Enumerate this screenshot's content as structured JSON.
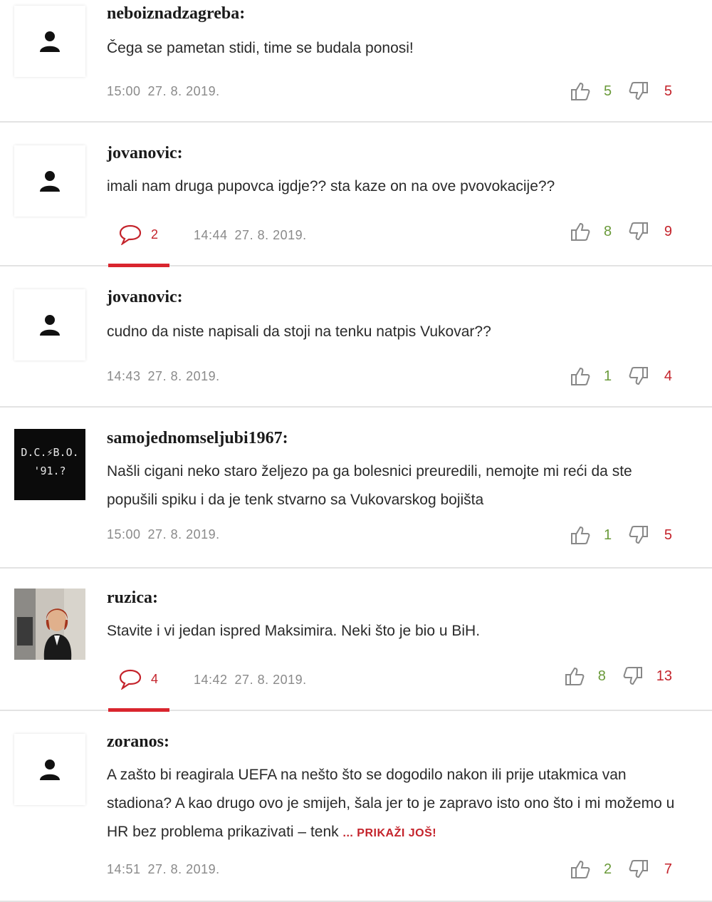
{
  "comments": [
    {
      "user": "neboiznadzagreba:",
      "text": "Čega se pametan stidi, time se budala ponosi!",
      "time": "15:00",
      "date": "27. 8. 2019.",
      "likes": "5",
      "dislikes": "5",
      "avatar": "default-user-icon"
    },
    {
      "user": "jovanovic:",
      "text": "imali nam druga pupovca igdje?? sta kaze on na ove pvovokacije??",
      "replies": "2",
      "time": "14:44",
      "date": "27. 8. 2019.",
      "likes": "8",
      "dislikes": "9",
      "avatar": "default-user-icon"
    },
    {
      "user": "jovanovic:",
      "text": "cudno da niste napisali da stoji na tenku natpis Vukovar??",
      "time": "14:43",
      "date": "27. 8. 2019.",
      "likes": "1",
      "dislikes": "4",
      "avatar": "default-user-icon"
    },
    {
      "user": "samojednomseljubi1967:",
      "text": "Našli cigani neko staro željezo pa ga bolesnici preuredili, nemojte mi reći da ste popušili spiku i da je tenk stvarno sa Vukovarskog bojišta",
      "time": "15:00",
      "date": "27. 8. 2019.",
      "likes": "1",
      "dislikes": "5",
      "avatar": "black-patch-image",
      "avatar_text_1": "D.C.⚡B.O.",
      "avatar_text_2": "'91.?"
    },
    {
      "user": "ruzica:",
      "text": "Stavite i vi jedan ispred Maksimira. Neki što je bio u BiH.",
      "replies": "4",
      "time": "14:42",
      "date": "27. 8. 2019.",
      "likes": "8",
      "dislikes": "13",
      "avatar": "woman-photo"
    },
    {
      "user": "zoranos:",
      "text": "A zašto bi reagirala UEFA na nešto što se dogodilo nakon ili prije utakmica van stadiona? A kao drugo ovo je smijeh, šala jer to je zapravo isto ono što i mi možemo u HR bez problema prikazivati – tenk",
      "more": "... PRIKAŽI JOŠ!",
      "time": "14:51",
      "date": "27. 8. 2019.",
      "likes": "2",
      "dislikes": "7",
      "avatar": "default-user-icon"
    }
  ],
  "colors": {
    "accent_red": "#c4232b",
    "like_green": "#6a9a3a",
    "meta_gray": "#8a8a8a"
  }
}
